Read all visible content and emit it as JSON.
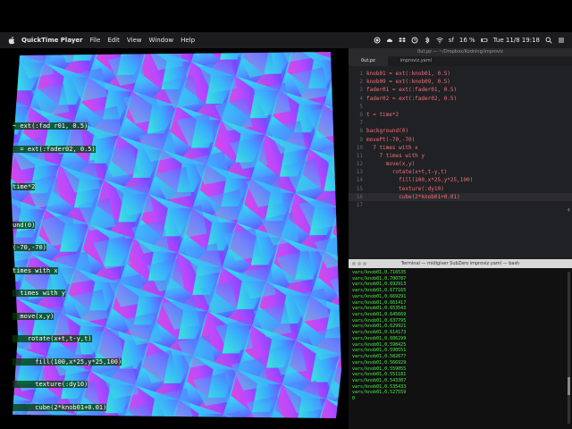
{
  "menubar": {
    "app_name": "QuickTime Player",
    "items": [
      "File",
      "Edit",
      "View",
      "Window",
      "Help"
    ],
    "status": {
      "keyboard": "sf",
      "battery": "16 %",
      "clock": "Tue 11/8 19:18"
    }
  },
  "video": {
    "overlay_lines": [
      "~ ext(:fad r01, 0.5)",
      "  = ext(:fader02, 0.5)",
      "",
      "time*2",
      "",
      "und(0)",
      "(-70,-70)",
      "times with x",
      "  times with y",
      "  move(x,y)",
      "    rotate(x+t,t-y,t)",
      "      fill(100,x*25,y*25,100)",
      "      texture(:dy10)",
      "      cube(2*knob01+0.01)"
    ]
  },
  "editor": {
    "window_title": "0ut.pz — ~/Dropbox/Kodning/improviz",
    "tabs": [
      "0ut.pz",
      "improviz.yaml"
    ],
    "lines": [
      "knob01 = ext(:knob01, 0.5)",
      "knob09 = ext(:knob09, 0.5)",
      "fader01 = ext(:fader01, 0.5)",
      "fader02 = ext(:fader02, 0.5)",
      "",
      "t = time*2",
      "",
      "background(0)",
      "movePt(-70,-70)",
      "  7 times with x",
      "    7 times with y",
      "      move(x,y)",
      "        rotate(x+t,t-y,t)",
      "          fill(100,x*25,y*25,100)",
      "          texture(:dy10)",
      "          cube(2*knob01+0.01)",
      ""
    ],
    "line_numbers": [
      "1",
      "2",
      "3",
      "4",
      "5",
      "6",
      "7",
      "8",
      "9",
      "10",
      "11",
      "12",
      "13",
      "14",
      "15",
      "16",
      "17"
    ]
  },
  "terminal": {
    "title": "Terminal — midigiver SubZero improviz.yaml — bash",
    "lines": [
      "vars/knob01,0.716535",
      "vars/knob01,0.700787",
      "vars/knob01,0.692913",
      "vars/knob01,0.677165",
      "vars/knob01,0.669291",
      "vars/knob01,0.661417",
      "vars/knob01,0.653543",
      "vars/knob01,0.645669",
      "vars/knob01,0.637795",
      "vars/knob01,0.629921",
      "vars/knob01,0.614173",
      "vars/knob01,0.606299",
      "vars/knob01,0.598425",
      "vars/knob01,0.590551",
      "vars/knob01,0.582677",
      "vars/knob01,0.566929",
      "vars/knob01,0.559055",
      "vars/knob01,0.551181",
      "vars/knob01,0.543307",
      "vars/knob01,0.535433",
      "vars/knob01,0.527559"
    ],
    "prompt": "0"
  }
}
